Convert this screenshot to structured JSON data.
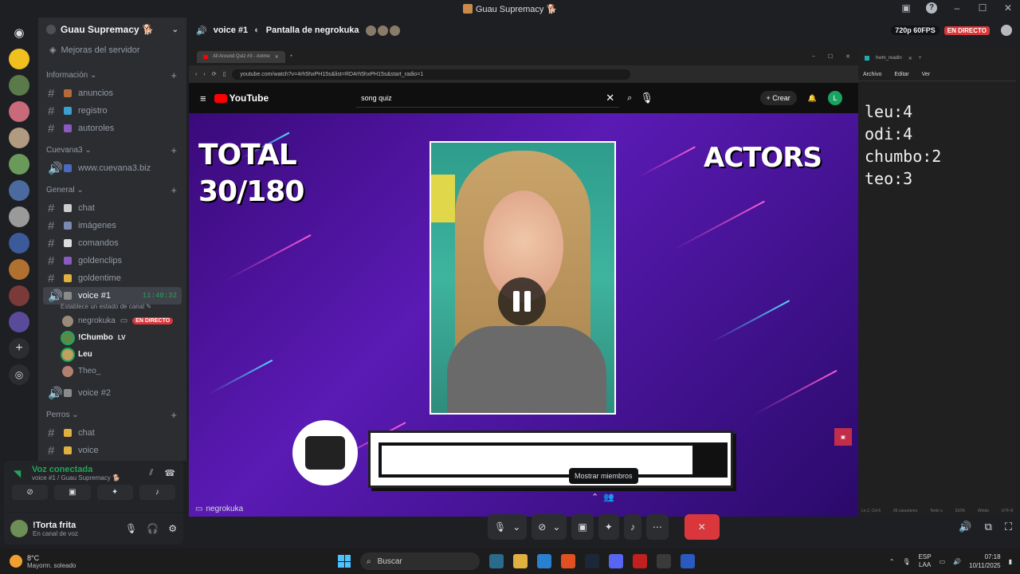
{
  "window": {
    "title": "Guau Supremacy 🐕"
  },
  "sidebar": {
    "guild_name": "Guau Supremacy 🐕",
    "boost": "Mejoras del servidor",
    "categories": [
      {
        "label": "Información",
        "channels": [
          "anuncios",
          "registro",
          "autoroles"
        ]
      },
      {
        "label": "Cuevana3",
        "channels": [
          "www.cuevana3.biz"
        ]
      },
      {
        "label": "General",
        "channels": [
          "chat",
          "imágenes",
          "comandos",
          "goldenclips",
          "goldentime"
        ]
      },
      {
        "label": "Perros",
        "channels": [
          "chat",
          "voice"
        ]
      }
    ],
    "voice_channel": {
      "name": "voice #1",
      "time": "11:40:32",
      "status_hint": "Establece un estado de canal"
    },
    "voice_members": [
      {
        "name": "negrokuka",
        "badge": "EN DIRECTO"
      },
      {
        "name": "!Chumbo",
        "badge": "LV"
      },
      {
        "name": "Leu",
        "badge": ""
      },
      {
        "name": "Theo_",
        "badge": ""
      }
    ],
    "voice_channel_2": "voice #2"
  },
  "voice_panel": {
    "status": "Voz conectada",
    "subtitle": "voice #1 / Guau Supremacy 🐕"
  },
  "user_panel": {
    "name": "!Torta frita",
    "status": "En canal de voz"
  },
  "stage_header": {
    "channel": "voice #1",
    "screen_title": "Pantalla de negrokuka",
    "quality": "720p 60FPS",
    "live": "EN DIRECTO"
  },
  "browser": {
    "tab_title": "All Around Quiz #3 - Anime",
    "url": "youtube.com/watch?v=4rh5hxPH15s&list=RD4rh5hxPH15s&start_radio=1",
    "search": "song quiz",
    "create": "Crear",
    "avatar_letter": "L",
    "logo": "YouTube"
  },
  "video": {
    "total_label": "TOTAL",
    "total_value": "30/180",
    "category": "ACTORS"
  },
  "notepad": {
    "tab_title": "hwm_readin",
    "menu": [
      "Archivo",
      "Editar",
      "Ver"
    ],
    "lines": [
      "leu:4",
      "odi:4",
      "chumbo:2",
      "teo:3"
    ],
    "status": [
      "Ln 2, Col 6",
      "26 caracteres",
      "Texto s",
      "310%",
      "Windo",
      "UTF-8"
    ]
  },
  "stream": {
    "streamer": "negrokuka",
    "tooltip": "Mostrar miembros"
  },
  "taskbar": {
    "temp": "8°C",
    "weather": "Mayorm. soleado",
    "search": "Buscar",
    "lang1": "ESP",
    "lang2": "LAA",
    "time": "07:18",
    "date": "10/11/2025"
  }
}
